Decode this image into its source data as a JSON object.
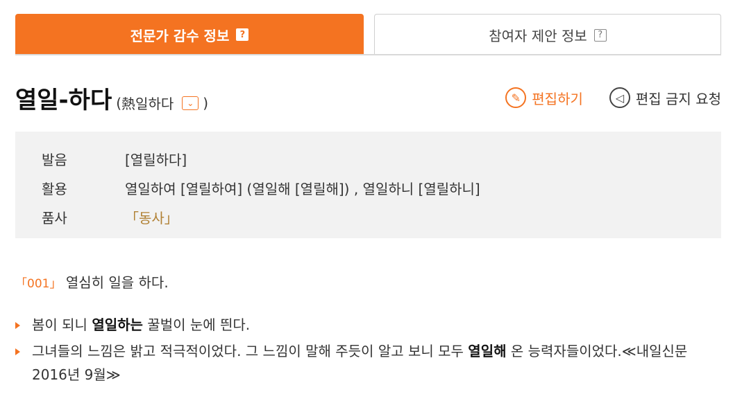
{
  "tabs": {
    "expert": "전문가 감수 정보",
    "participant": "참여자 제안 정보",
    "help_mark": "?"
  },
  "entry": {
    "headword": "열일-하다",
    "original_open": "(",
    "original": "熱일하다",
    "original_close": ")"
  },
  "actions": {
    "edit": "편집하기",
    "ban_request": "편집 금지 요청"
  },
  "info": {
    "pronunciation_label": "발음",
    "pronunciation_value": "[열릴하다]",
    "conjugation_label": "활용",
    "conjugation_value": "열일하여 [열릴하여] (열일해 [열릴해]) , 열일하니 [열릴하니]",
    "pos_label": "품사",
    "pos_value": "「동사」"
  },
  "sense": {
    "number": "「001」",
    "definition": "열심히 일을 하다."
  },
  "examples": [
    {
      "before": "봄이 되니 ",
      "bold": "열일하는",
      "after": " 꿀벌이 눈에 띈다."
    },
    {
      "before": "그녀들의 느낌은 밝고 적극적이었다. 그 느낌이 말해 주듯이 알고 보니 모두 ",
      "bold": "열일해",
      "after": " 온 능력자들이었다.≪내일신문 2016년 9월≫"
    }
  ],
  "icons": {
    "edit": "pencil-circle-icon",
    "ban": "megaphone-circle-icon",
    "expand": "chevron-down-icon",
    "bullet": "triangle-bullet-icon"
  },
  "colors": {
    "accent": "#f47321",
    "pos": "#b08033",
    "panel": "#f2f2f2"
  }
}
